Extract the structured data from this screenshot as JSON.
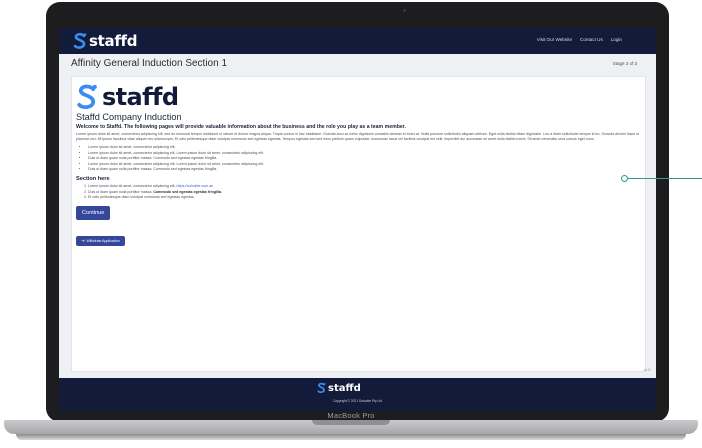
{
  "device": {
    "model_label": "MacBook Pro"
  },
  "header": {
    "brand": "staffd",
    "nav": [
      "Visit Our Website",
      "Contact Us",
      "Login"
    ]
  },
  "titlebar": {
    "title": "Affinity General Induction Section 1",
    "stage": "Stage 2 of 3"
  },
  "content": {
    "hero_brand": "staffd",
    "heading": "Staffd Company Induction",
    "welcome": "Welcome to Staffd. The following pages will provide valuable information about the business and the role you play as a team member.",
    "paragraph": "Lorem ipsum dolor sit amet, consectetur adipiscing elit, sed do eiusmod tempor incididunt ut labore et dolore magna aliqua. Turpis cursus in hac habitasse. Gravida arcu ac tortor dignissim convallis aenean et tortor at. Nulla posuere sollicitudin aliquam ultrices. Eget nulla facilisi etiam dignissim. Leo a diam sollicitudin tempor id eu. Gravida dictum fusce ut placerat orci. Mi ipsum faucibus vitae aliquet nec ullamcorper. Et odio pellentesque diam volutpat commodo sed egestas egestas. Tempus egestas sed sed risus pretium quam vulputate. Accumsan lacus vel facilisis volutpat est velit. Imperdiet dui accumsan sit amet nulla facilisi morbi. Sit amet venenatis urna cursus eget nunc.",
    "bullets": [
      "Lorem ipsum dolor sit amet, consectetur adipiscing elit.",
      "Lorem ipsum dolor sit amet, consectetur adipiscing elit. Lorem ipsum dolor sit amet, consectetur adipiscing elit.",
      "Duis ut diam quam nulla porttitor massa. Commodo sed egestas egestas fringilla.",
      "Lorem ipsum dolor sit amet, consectetur adipiscing elit. Lorem ipsum dolor sit amet, consectetur adipiscing elit.",
      "Duis ut diam quam nulla porttitor massa. Commodo sed egestas egestas fringilla."
    ],
    "section_heading": "Section here",
    "numbered": {
      "item1_text": "Lorem ipsum dolor sit amet, consectetur adipiscing elit.",
      "item1_link": "https://solvable.com.au",
      "item2_text": "Duis ut diam quam nulla porttitor massa.",
      "item2_bold": "Commodo sed egestas egestas fringilla.",
      "item3_text": "Et odio pellentesque diam volutpat commodo sed egestas egestas."
    },
    "continue_label": "Continue",
    "withdraw_icon": "exit-arrow-icon",
    "withdraw_label": "Withdraw Application",
    "version": "v1.3"
  },
  "footer": {
    "brand": "staffd",
    "copyright": "Copyright © 2021 Solvable Pty Ltd"
  },
  "colors": {
    "navy": "#131b3a",
    "button": "#34479a",
    "accent_teal": "#2e9b8c",
    "logo_blue": "#3a8df0"
  }
}
